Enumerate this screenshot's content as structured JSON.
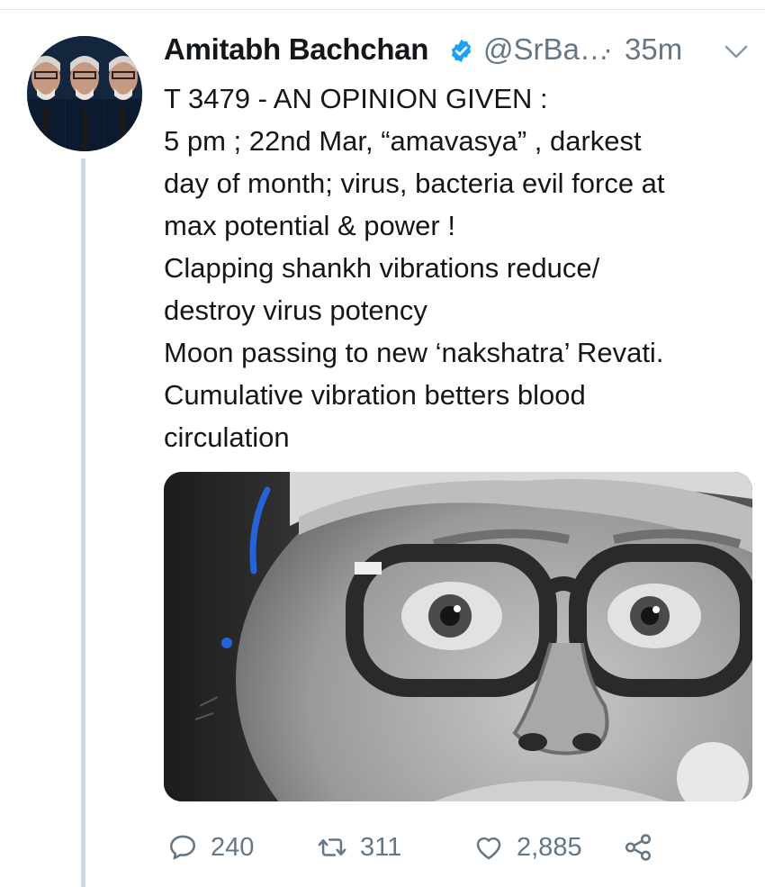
{
  "tweet": {
    "author_name": "Amitabh Bachchan",
    "handle": "@SrBa…",
    "separator": "·",
    "time": "35m",
    "lines": [
      "T 3479 - AN OPINION GIVEN :",
      "5 pm ; 22nd Mar, “amavasya” , darkest",
      "day of month; virus, bacteria evil force at",
      "max potential & power !",
      "Clapping shankh vibrations reduce/",
      "destroy virus potency",
      "Moon passing to new ‘nakshatra’ Revati.",
      "Cumulative vibration betters blood",
      "circulation"
    ]
  },
  "actions": {
    "replies": "240",
    "retweets": "311",
    "likes": "2,885"
  },
  "colors": {
    "text": "#14171a",
    "secondary": "#657786",
    "verified": "#1da1f2",
    "divider": "#e1e8ed"
  },
  "icons": {
    "verified": "verified-badge-icon",
    "more": "chevron-down-icon",
    "reply": "reply-icon",
    "retweet": "retweet-icon",
    "like": "heart-icon",
    "share": "share-icon"
  }
}
